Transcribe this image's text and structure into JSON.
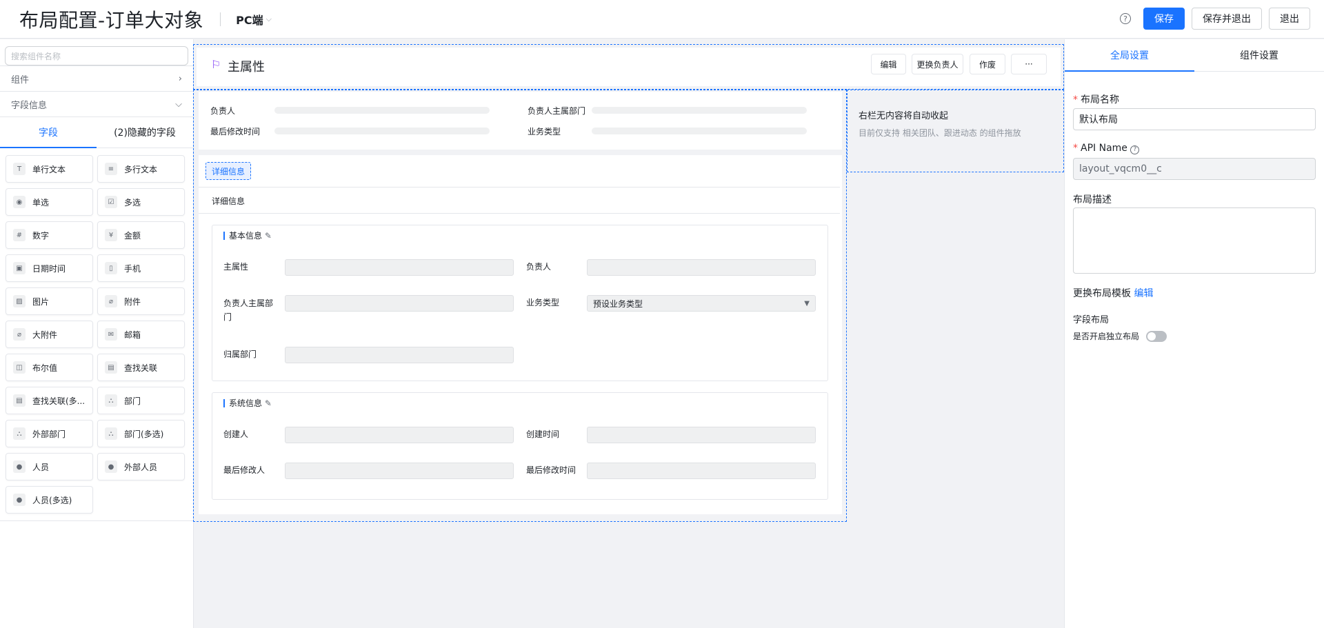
{
  "header": {
    "title": "布局配置-订单大对象",
    "platform": "PC端",
    "buttons": {
      "save": "保存",
      "save_exit": "保存并退出",
      "exit": "退出"
    }
  },
  "left_panel": {
    "search_placeholder": "搜索组件名称",
    "sections": [
      "组件",
      "字段信息"
    ],
    "tabs": [
      "字段",
      "(2)隐藏的字段"
    ],
    "fields": [
      {
        "label": "单行文本",
        "icon": "T"
      },
      {
        "label": "多行文本",
        "icon": "≡"
      },
      {
        "label": "单选",
        "icon": "◉"
      },
      {
        "label": "多选",
        "icon": "☑"
      },
      {
        "label": "数字",
        "icon": "#"
      },
      {
        "label": "金额",
        "icon": "¥"
      },
      {
        "label": "日期时间",
        "icon": "▣"
      },
      {
        "label": "手机",
        "icon": "▯"
      },
      {
        "label": "图片",
        "icon": "▨"
      },
      {
        "label": "附件",
        "icon": "⌀"
      },
      {
        "label": "大附件",
        "icon": "⌀"
      },
      {
        "label": "邮箱",
        "icon": "✉"
      },
      {
        "label": "布尔值",
        "icon": "◫"
      },
      {
        "label": "查找关联",
        "icon": "▤"
      },
      {
        "label": "查找关联(多...",
        "icon": "▤"
      },
      {
        "label": "部门",
        "icon": "⛬"
      },
      {
        "label": "外部部门",
        "icon": "⛬"
      },
      {
        "label": "部门(多选)",
        "icon": "⛬"
      },
      {
        "label": "人员",
        "icon": "●"
      },
      {
        "label": "外部人员",
        "icon": "●"
      },
      {
        "label": "人员(多选)",
        "icon": "●"
      }
    ]
  },
  "canvas": {
    "main_title": "主属性",
    "actions": [
      "编辑",
      "更换负责人",
      "作废",
      "···"
    ],
    "summary": [
      "负责人",
      "负责人主属部门",
      "最后修改时间",
      "业务类型"
    ],
    "right_column": {
      "title": "右栏无内容将自动收起",
      "hint": "目前仅支持 相关团队、跟进动态 的组件拖放"
    },
    "detail_tab": "详细信息",
    "detail_heading": "详细信息",
    "basic": {
      "title": "基本信息",
      "fields": [
        "主属性",
        "负责人",
        "负责人主属部门",
        "业务类型",
        "归属部门"
      ],
      "business_type_value": "预设业务类型"
    },
    "system": {
      "title": "系统信息",
      "fields": [
        "创建人",
        "创建时间",
        "最后修改人",
        "最后修改时间"
      ]
    }
  },
  "right_panel": {
    "tabs": [
      "全局设置",
      "组件设置"
    ],
    "layout_name_label": "布局名称",
    "layout_name_value": "默认布局",
    "api_name_label": "API Name",
    "api_name_value": "layout_vqcm0__c",
    "desc_label": "布局描述",
    "template_label": "更换布局模板",
    "template_edit": "编辑",
    "field_layout_label": "字段布局",
    "independent_label": "是否开启独立布局"
  }
}
